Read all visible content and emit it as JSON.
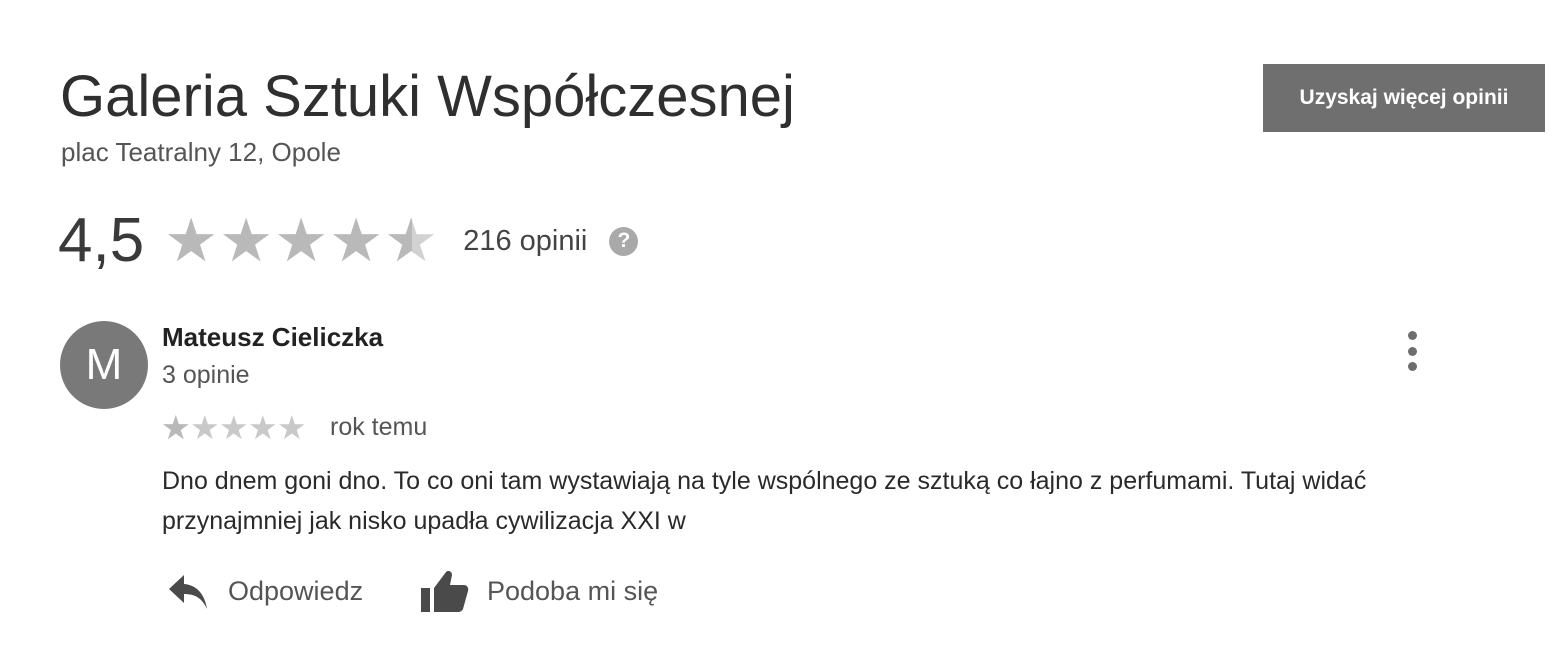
{
  "place": {
    "name": "Galeria Sztuki Współczesnej",
    "address": "plac Teatralny 12, Opole"
  },
  "get_more_reviews_label": "Uzyskaj więcej opinii",
  "rating": {
    "value_text": "4,5",
    "value": 4.5,
    "max": 5,
    "review_count_text": "216 opinii",
    "help_icon": "?"
  },
  "review": {
    "author_initial": "M",
    "author_name": "Mateusz Cieliczka",
    "author_reviews": "3 opinie",
    "stars": 1,
    "stars_max": 5,
    "time": "rok temu",
    "text": "Dno dnem goni dno. To co oni tam wystawiają na tyle wspólnego ze sztuką co łajno z perfumami. Tutaj widać przynajmniej jak nisko upadła cywilizacja XXI w"
  },
  "actions": {
    "reply_label": "Odpowiedz",
    "like_label": "Podoba mi się"
  },
  "icons": {
    "help": "help-icon",
    "menu": "more-vert-icon",
    "reply": "reply-arrow-icon",
    "like": "thumb-up-icon"
  },
  "colors": {
    "button_bg": "#6f6f6f",
    "avatar_bg": "#797979",
    "star_filled": "#b9b9b9",
    "star_empty": "#d2d2d2"
  }
}
